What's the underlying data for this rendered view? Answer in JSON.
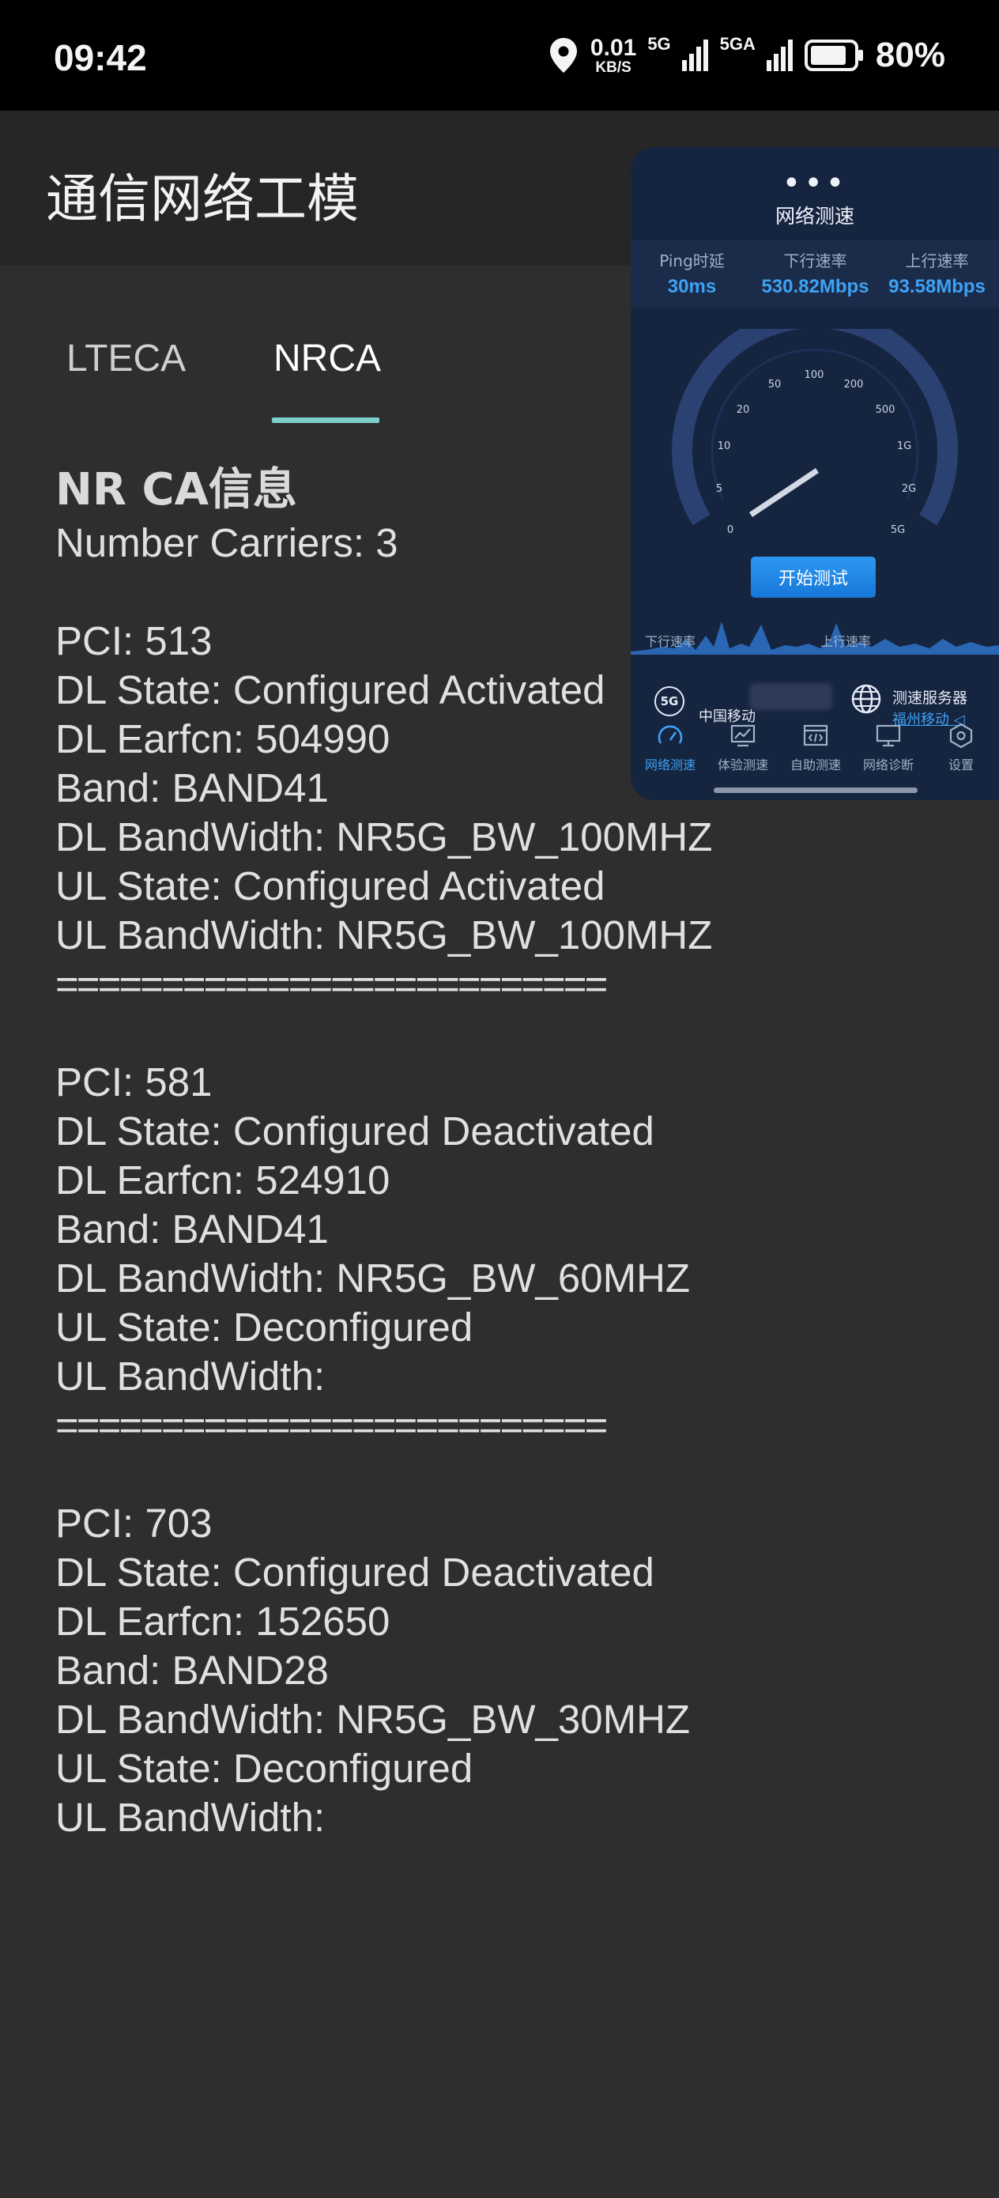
{
  "status_bar": {
    "time": "09:42",
    "speed_value": "0.01",
    "speed_unit": "KB/S",
    "net1": "5G",
    "net2": "5GA",
    "battery": "80%"
  },
  "app": {
    "title": "通信网络工模",
    "tabs": [
      "LTECA",
      "NRCA"
    ],
    "active_tab": "NRCA"
  },
  "nrca": {
    "heading": "NR CA信息",
    "carriers_line": "Number Carriers: 3",
    "separator": "==========================",
    "carriers": [
      {
        "pci": "PCI: 513",
        "dl_state": "DL State: Configured Activated",
        "dl_earfcn": "DL Earfcn: 504990",
        "band": "Band: BAND41",
        "dl_bw": "DL BandWidth: NR5G_BW_100MHZ",
        "ul_state": "UL State: Configured Activated",
        "ul_bw": "UL BandWidth: NR5G_BW_100MHZ"
      },
      {
        "pci": "PCI: 581",
        "dl_state": "DL State: Configured Deactivated",
        "dl_earfcn": "DL Earfcn: 524910",
        "band": "Band: BAND41",
        "dl_bw": "DL BandWidth: NR5G_BW_60MHZ",
        "ul_state": "UL State: Deconfigured",
        "ul_bw": "UL BandWidth:"
      },
      {
        "pci": "PCI: 703",
        "dl_state": "DL State: Configured Deactivated",
        "dl_earfcn": "DL Earfcn: 152650",
        "band": "Band: BAND28",
        "dl_bw": "DL BandWidth: NR5G_BW_30MHZ",
        "ul_state": "UL State: Deconfigured",
        "ul_bw": "UL BandWidth:"
      }
    ]
  },
  "speedtest": {
    "more": "•••",
    "title": "网络测速",
    "ping_label": "Ping时延",
    "ping_value": "30ms",
    "down_label": "下行速率",
    "down_value": "530.82Mbps",
    "up_label": "上行速率",
    "up_value": "93.58Mbps",
    "gauge_ticks": [
      "0",
      "5",
      "10",
      "20",
      "50",
      "100",
      "200",
      "500",
      "1G",
      "2G",
      "5G"
    ],
    "start_button": "开始测试",
    "wave_down_label": "下行速率",
    "wave_up_label": "上行速率",
    "net_badge": "5G",
    "carrier": "中国移动",
    "server_title": "测速服务器",
    "server_name": "福州移动 ◁",
    "nav": [
      "网络测速",
      "体验测速",
      "自助测速",
      "网络诊断",
      "设置"
    ],
    "nav_active": "网络测速",
    "accent_color": "#3ea2f5",
    "panel_color": "#15243f"
  }
}
